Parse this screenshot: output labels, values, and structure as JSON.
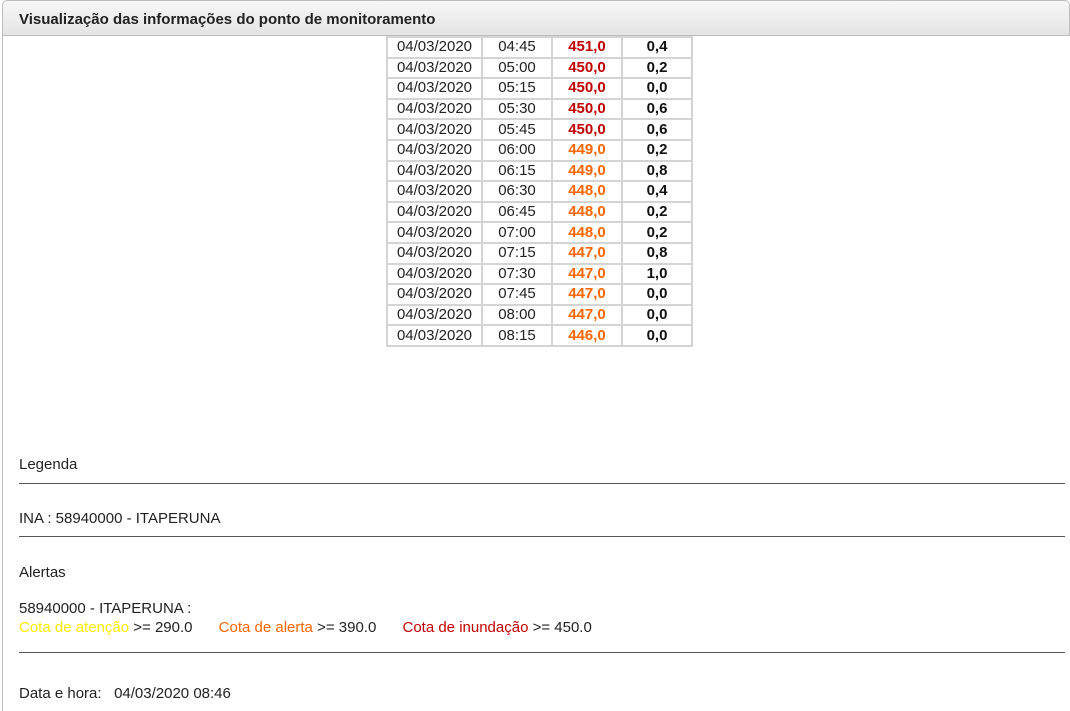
{
  "title": "Visualização das informações do ponto de monitoramento",
  "colors": {
    "atencao": "#ffee00",
    "alerta": "#ff6600",
    "inundacao": "#c00000"
  },
  "readings": [
    {
      "date": "04/03/2020",
      "time": "04:45",
      "level": "451,0",
      "rain": "0,4",
      "status": "inundacao"
    },
    {
      "date": "04/03/2020",
      "time": "05:00",
      "level": "450,0",
      "rain": "0,2",
      "status": "inundacao"
    },
    {
      "date": "04/03/2020",
      "time": "05:15",
      "level": "450,0",
      "rain": "0,0",
      "status": "inundacao"
    },
    {
      "date": "04/03/2020",
      "time": "05:30",
      "level": "450,0",
      "rain": "0,6",
      "status": "inundacao"
    },
    {
      "date": "04/03/2020",
      "time": "05:45",
      "level": "450,0",
      "rain": "0,6",
      "status": "inundacao"
    },
    {
      "date": "04/03/2020",
      "time": "06:00",
      "level": "449,0",
      "rain": "0,2",
      "status": "alerta"
    },
    {
      "date": "04/03/2020",
      "time": "06:15",
      "level": "449,0",
      "rain": "0,8",
      "status": "alerta"
    },
    {
      "date": "04/03/2020",
      "time": "06:30",
      "level": "448,0",
      "rain": "0,4",
      "status": "alerta"
    },
    {
      "date": "04/03/2020",
      "time": "06:45",
      "level": "448,0",
      "rain": "0,2",
      "status": "alerta"
    },
    {
      "date": "04/03/2020",
      "time": "07:00",
      "level": "448,0",
      "rain": "0,2",
      "status": "alerta"
    },
    {
      "date": "04/03/2020",
      "time": "07:15",
      "level": "447,0",
      "rain": "0,8",
      "status": "alerta"
    },
    {
      "date": "04/03/2020",
      "time": "07:30",
      "level": "447,0",
      "rain": "1,0",
      "status": "alerta"
    },
    {
      "date": "04/03/2020",
      "time": "07:45",
      "level": "447,0",
      "rain": "0,0",
      "status": "alerta"
    },
    {
      "date": "04/03/2020",
      "time": "08:00",
      "level": "447,0",
      "rain": "0,0",
      "status": "alerta"
    },
    {
      "date": "04/03/2020",
      "time": "08:15",
      "level": "446,0",
      "rain": "0,0",
      "status": "alerta"
    }
  ],
  "legend": {
    "heading": "Legenda",
    "station": "INA : 58940000 - ITAPERUNA"
  },
  "alerts": {
    "heading": "Alertas",
    "station": "58940000 - ITAPERUNA :",
    "atencao_label": "Cota de atenção",
    "atencao_value": ">= 290.0",
    "alerta_label": "Cota de alerta",
    "alerta_value": ">= 390.0",
    "inundacao_label": "Cota de inundação",
    "inundacao_value": ">= 450.0"
  },
  "datetime": {
    "label": "Data e hora:",
    "value": "04/03/2020 08:46"
  }
}
